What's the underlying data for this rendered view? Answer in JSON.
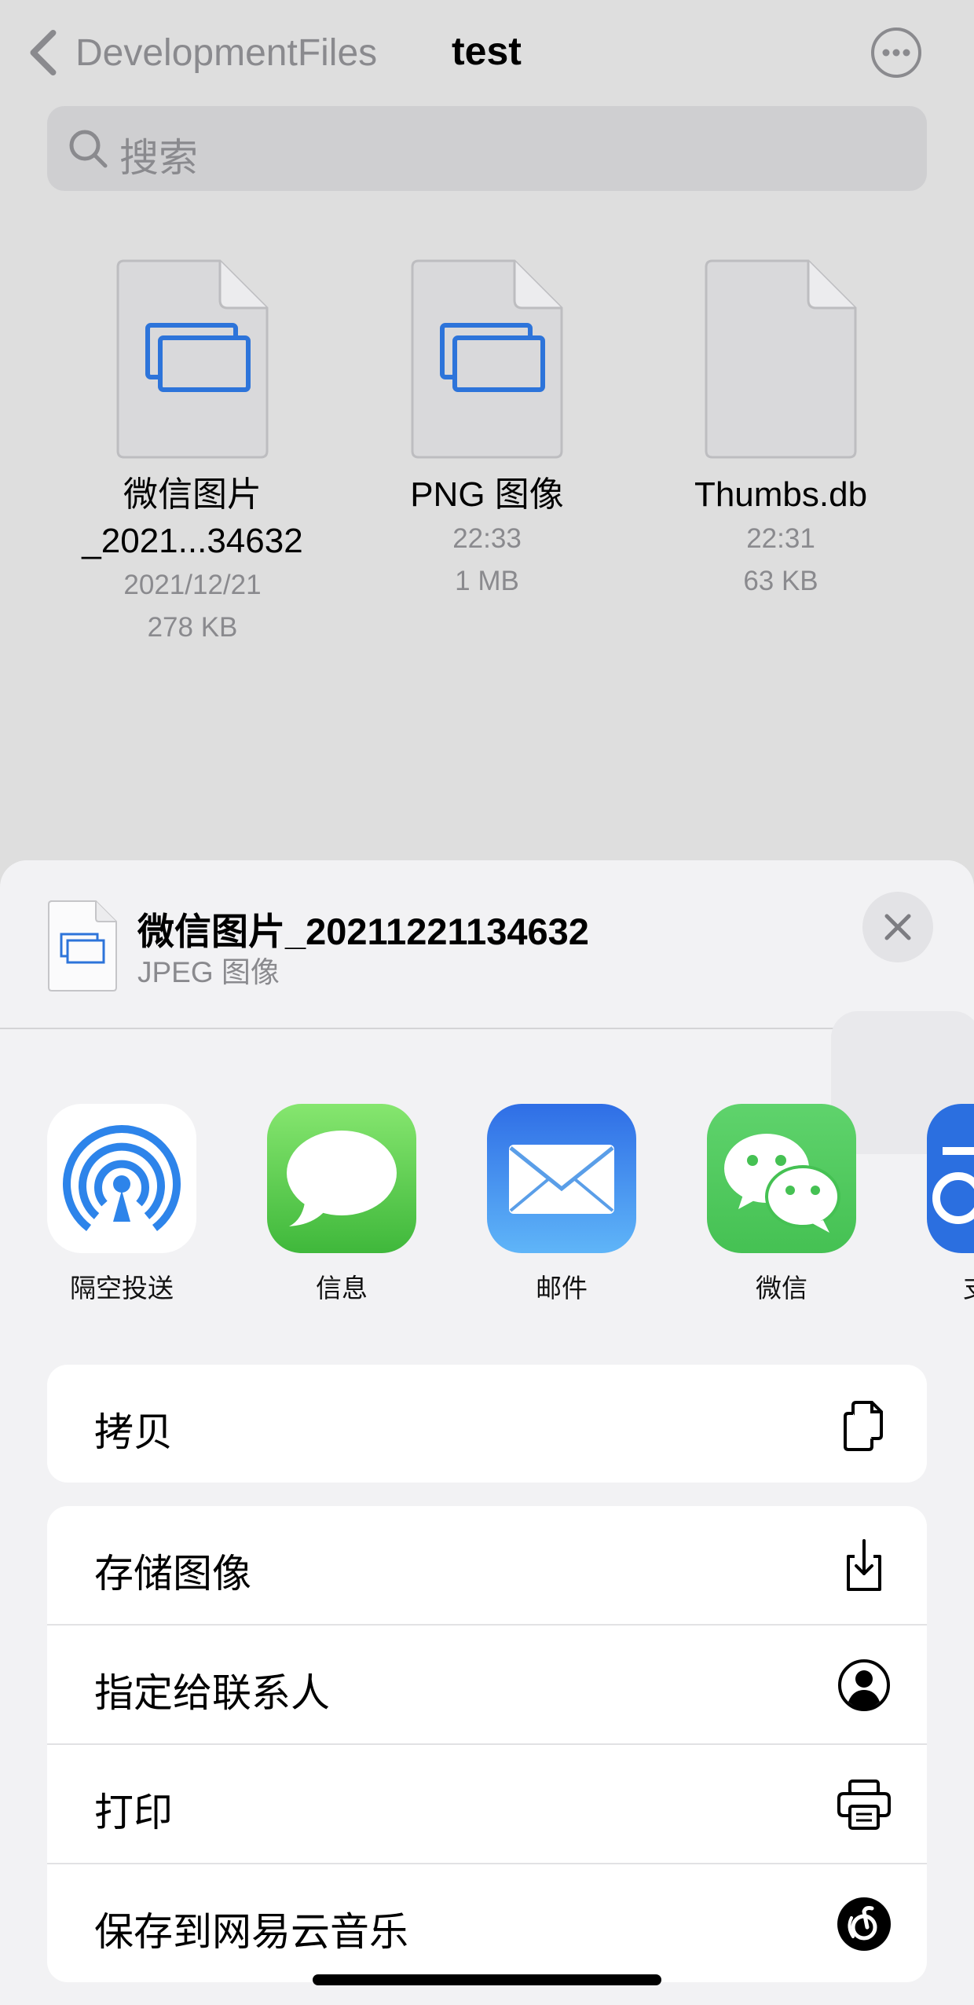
{
  "nav": {
    "back_label": "DevelopmentFiles",
    "title": "test"
  },
  "search": {
    "placeholder": "搜索"
  },
  "files": [
    {
      "name_line1": "微信图片",
      "name_line2": "_2021...34632",
      "date": "2021/12/21",
      "size": "278 KB",
      "icon": "image-document-icon"
    },
    {
      "name_line1": "PNG 图像",
      "time": "22:33",
      "size": "1 MB",
      "icon": "image-document-icon"
    },
    {
      "name_line1": "Thumbs.db",
      "time": "22:31",
      "size": "63 KB",
      "icon": "blank-document-icon"
    }
  ],
  "share": {
    "title": "微信图片_20211221134632",
    "subtitle": "JPEG 图像",
    "apps": [
      {
        "label": "隔空投送",
        "icon": "airdrop-icon"
      },
      {
        "label": "信息",
        "icon": "messages-icon"
      },
      {
        "label": "邮件",
        "icon": "mail-icon"
      },
      {
        "label": "微信",
        "icon": "wechat-icon"
      },
      {
        "label": "支",
        "icon": "partial-app-icon"
      }
    ],
    "actions_group1": [
      {
        "label": "拷贝",
        "icon": "copy-icon"
      }
    ],
    "actions_group2": [
      {
        "label": "存储图像",
        "icon": "save-download-icon"
      },
      {
        "label": "指定给联系人",
        "icon": "contact-icon"
      },
      {
        "label": "打印",
        "icon": "printer-icon"
      },
      {
        "label": "保存到网易云音乐",
        "icon": "netease-music-icon"
      }
    ]
  },
  "colors": {
    "accent_blue": "#2d74da",
    "background": "#dedede",
    "sheet": "#f2f2f4",
    "secondary_text": "#8a8a8e"
  }
}
